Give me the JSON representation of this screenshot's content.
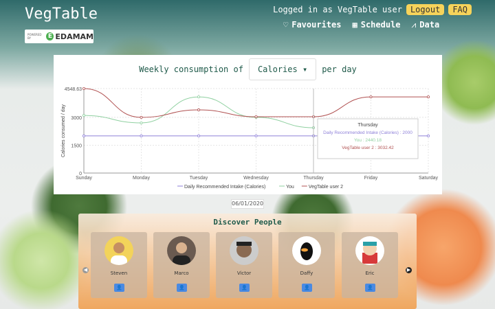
{
  "header": {
    "logo_text": "VegTable",
    "powered_by": "POWERED BY",
    "provider": "EDAMAM",
    "logged_in_text": "Logged in as VegTable user",
    "logout_label": "Logout",
    "faq_label": "FAQ",
    "nav": [
      {
        "label": "Favourites",
        "icon": "heart-icon"
      },
      {
        "label": "Schedule",
        "icon": "calendar-icon"
      },
      {
        "label": "Data",
        "icon": "chart-icon"
      }
    ]
  },
  "chart_controls": {
    "prefix": "Weekly consumption of",
    "selected_metric": "Calories",
    "suffix": "per day"
  },
  "chart_data": {
    "type": "line",
    "ylabel": "Calories consumed / day",
    "categories": [
      "Sunday",
      "Monday",
      "Tuesday",
      "Wednesday",
      "Thursday",
      "Friday",
      "Saturday"
    ],
    "y_ticks": [
      "0",
      "1500",
      "3000",
      "4548.63"
    ],
    "ylim": [
      0,
      4548.63
    ],
    "grid": true,
    "legend_position": "bottom",
    "series": [
      {
        "name": "Daily Recommended Intake (Calories)",
        "color": "#8d7fd8",
        "values": [
          2000,
          2000,
          2000,
          2000,
          2000,
          null,
          2000
        ]
      },
      {
        "name": "You",
        "color": "#8fd0a0",
        "values": [
          3100,
          2700,
          4100,
          3000,
          2440.18,
          null,
          null
        ]
      },
      {
        "name": "VegTable user 2",
        "color": "#b05050",
        "values": [
          4548.63,
          3000,
          3400,
          3032,
          3032.42,
          4100,
          4100
        ]
      }
    ],
    "tooltip": {
      "title": "Thursday",
      "lines": [
        {
          "text": "Daily Recommended Intake (Calories) : 2000",
          "color": "#8d7fd8"
        },
        {
          "text": "You : 2440.18",
          "color": "#8fd0a0"
        },
        {
          "text": "VegTable user 2 : 3032.42",
          "color": "#b05050"
        }
      ]
    }
  },
  "date": "06/01/2020",
  "discover": {
    "title": "Discover People",
    "people": [
      {
        "name": "Steven"
      },
      {
        "name": "Marco"
      },
      {
        "name": "Victor"
      },
      {
        "name": "Daffy"
      },
      {
        "name": "Eric"
      }
    ]
  }
}
